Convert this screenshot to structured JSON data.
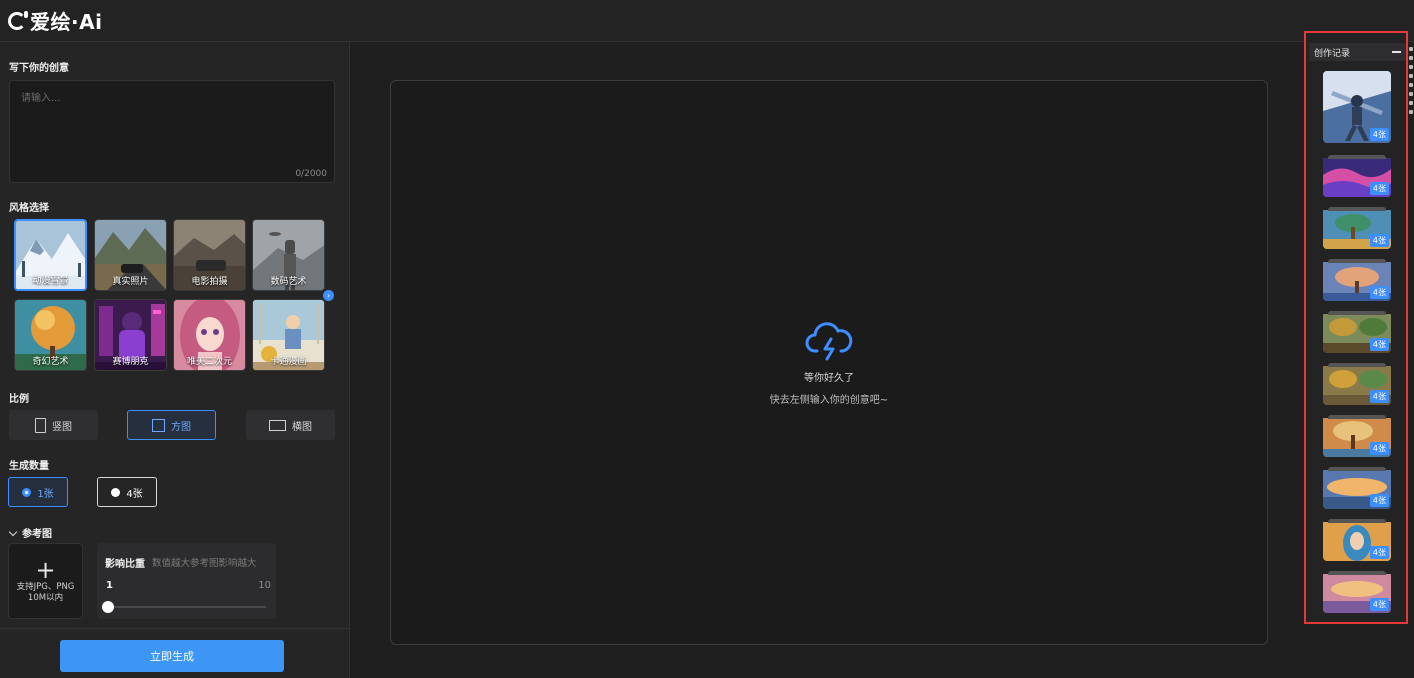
{
  "app": {
    "title": "爱绘·Ai"
  },
  "prompt": {
    "title": "写下你的创意",
    "placeholder": "请输入...",
    "counter": "0/2000"
  },
  "style": {
    "title": "风格选择",
    "items": [
      {
        "label": "动漫雪景",
        "selected": true
      },
      {
        "label": "真实照片",
        "selected": false
      },
      {
        "label": "电影拍摄",
        "selected": false
      },
      {
        "label": "数码艺术",
        "selected": false
      },
      {
        "label": "奇幻艺术",
        "selected": false
      },
      {
        "label": "赛博朋克",
        "selected": false
      },
      {
        "label": "唯美二次元",
        "selected": false
      },
      {
        "label": "卡通漫画",
        "selected": false
      }
    ]
  },
  "ratio": {
    "title": "比例",
    "options": [
      {
        "label": "竖图",
        "selected": false
      },
      {
        "label": "方图",
        "selected": true
      },
      {
        "label": "横图",
        "selected": false
      }
    ]
  },
  "quantity": {
    "title": "生成数量",
    "options": [
      {
        "label": "1张",
        "selected": true
      },
      {
        "label": "4张",
        "selected": false
      }
    ]
  },
  "reference": {
    "title": "参考图",
    "upload_plus": "+",
    "upload_line1": "支持JPG、PNG",
    "upload_line2": "10M以内",
    "weight_title": "影响比重",
    "weight_hint": "数值越大参考图影响越大",
    "min": "1",
    "max": "10",
    "value": 1
  },
  "generate": {
    "label": "立即生成"
  },
  "canvas": {
    "line1": "等你好久了",
    "line2": "快去左侧输入你的创意吧~"
  },
  "history": {
    "title": "创作记录",
    "items": [
      {
        "badge": "4张"
      },
      {
        "badge": "4张"
      },
      {
        "badge": "4张"
      },
      {
        "badge": "4张"
      },
      {
        "badge": "4张"
      },
      {
        "badge": "4张"
      },
      {
        "badge": "4张"
      },
      {
        "badge": "4张"
      },
      {
        "badge": "4张"
      },
      {
        "badge": "4张"
      }
    ]
  },
  "colors": {
    "accent": "#3d8eff",
    "highlight": "#e8393a",
    "button": "#3d95f5"
  }
}
